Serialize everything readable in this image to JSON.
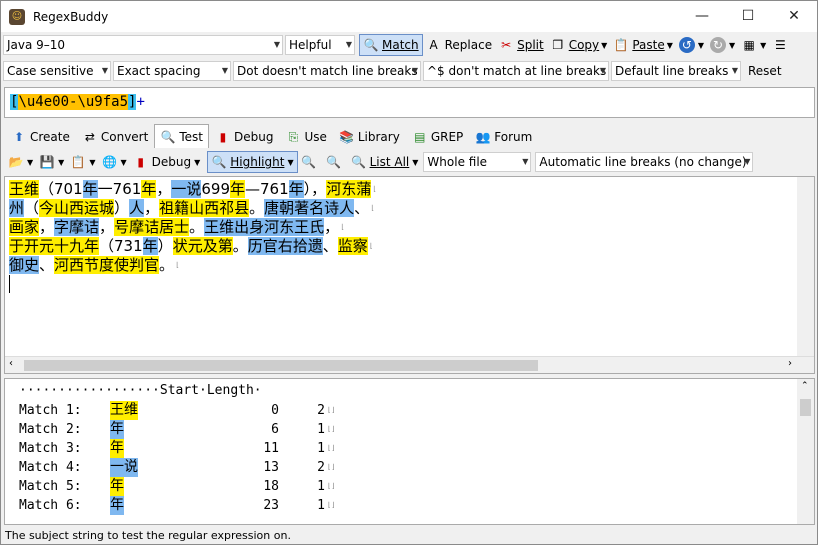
{
  "window": {
    "title": "RegexBuddy"
  },
  "toolbar1": {
    "flavor": "Java 9–10",
    "helper": "Helpful",
    "match": "Match",
    "replace": "Replace",
    "split": "Split",
    "copy": "Copy",
    "paste": "Paste"
  },
  "toolbar2": {
    "case": "Case sensitive",
    "spacing": "Exact spacing",
    "dot": "Dot doesn't match line breaks",
    "anchors": "^$ don't match at line breaks",
    "linebreaks": "Default line breaks",
    "reset": "Reset"
  },
  "regex": {
    "open": "[",
    "range": "\\u4e00-\\u9fa5",
    "close": "]",
    "quant": "+"
  },
  "tabs": [
    "Create",
    "Convert",
    "Test",
    "Debug",
    "Use",
    "Library",
    "GREP",
    "Forum"
  ],
  "testbar": {
    "debug": "Debug",
    "highlight": "Highlight",
    "listall": "List All",
    "scope": "Whole file",
    "linebreaks": "Automatic line breaks (no change)"
  },
  "subject_lines": [
    [
      [
        "王维",
        "y"
      ],
      [
        "（701",
        ""
      ],
      [
        "年",
        "b"
      ],
      [
        "一761",
        ""
      ],
      [
        "年",
        "y"
      ],
      [
        "，",
        ""
      ],
      [
        "一说",
        "b"
      ],
      [
        "699",
        ""
      ],
      [
        "年",
        "y"
      ],
      [
        "—761",
        ""
      ],
      [
        "年",
        "b"
      ],
      [
        "），",
        ""
      ],
      [
        "河东蒲",
        "y"
      ]
    ],
    [
      [
        "州",
        "b"
      ],
      [
        "（",
        ""
      ],
      [
        "今山西运城",
        "y"
      ],
      [
        "）",
        ""
      ],
      [
        "人",
        "b"
      ],
      [
        "，",
        ""
      ],
      [
        "祖籍山西祁县",
        "y"
      ],
      [
        "。",
        ""
      ],
      [
        "唐朝著名诗人",
        "b"
      ],
      [
        "、",
        ""
      ]
    ],
    [
      [
        "画家",
        "y"
      ],
      [
        "，",
        ""
      ],
      [
        "字摩诘",
        "b"
      ],
      [
        "，",
        ""
      ],
      [
        "号摩诘居士",
        "y"
      ],
      [
        "。",
        ""
      ],
      [
        "王维出身河东王氏",
        "b"
      ],
      [
        "，",
        ""
      ]
    ],
    [
      [
        "于开元十九年",
        "y"
      ],
      [
        "（731",
        ""
      ],
      [
        "年",
        "b"
      ],
      [
        "）",
        ""
      ],
      [
        "状元及第",
        "y"
      ],
      [
        "。",
        ""
      ],
      [
        "历官右拾遗",
        "b"
      ],
      [
        "、",
        ""
      ],
      [
        "监察",
        "y"
      ]
    ],
    [
      [
        "御史",
        "b"
      ],
      [
        "、",
        ""
      ],
      [
        "河西节度使判官",
        "y"
      ],
      [
        "。",
        ""
      ]
    ]
  ],
  "results": {
    "header": "··················Start·Length·",
    "rows": [
      {
        "label": "Match 1:",
        "text": "王维",
        "color": "y",
        "start": "0",
        "length": "2"
      },
      {
        "label": "Match 2:",
        "text": "年",
        "color": "b",
        "start": "6",
        "length": "1"
      },
      {
        "label": "Match 3:",
        "text": "年",
        "color": "y",
        "start": "11",
        "length": "1"
      },
      {
        "label": "Match 4:",
        "text": "一说",
        "color": "b",
        "start": "13",
        "length": "2"
      },
      {
        "label": "Match 5:",
        "text": "年",
        "color": "y",
        "start": "18",
        "length": "1"
      },
      {
        "label": "Match 6:",
        "text": "年",
        "color": "b",
        "start": "23",
        "length": "1"
      }
    ]
  },
  "status": "The subject string to test the regular expression on.",
  "colors": {
    "highlight_yellow": "#ffee00",
    "highlight_blue": "#7fb8f0"
  }
}
